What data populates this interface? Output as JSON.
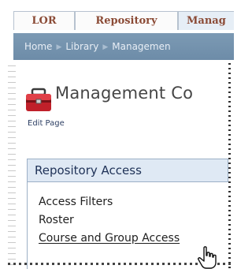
{
  "tabs": [
    {
      "label": "LOR"
    },
    {
      "label": "Repository"
    },
    {
      "label": "Manag"
    }
  ],
  "breadcrumb": {
    "items": [
      "Home",
      "Library",
      "Managemen"
    ]
  },
  "page": {
    "title": "Management Co",
    "edit_link": "Edit Page",
    "title_icon": "toolbox-icon"
  },
  "repository_access": {
    "heading": "Repository Access",
    "links": [
      {
        "label": "Access Filters"
      },
      {
        "label": "Roster"
      },
      {
        "label": "Course and Group Access"
      }
    ]
  },
  "cursor": {
    "icon": "hand-pointer-icon"
  },
  "colors": {
    "tab_text": "#8b4b36",
    "breadcrumb_bar": "#7593ae",
    "panel_header": "#dfe9f4",
    "title_text": "#464646"
  }
}
